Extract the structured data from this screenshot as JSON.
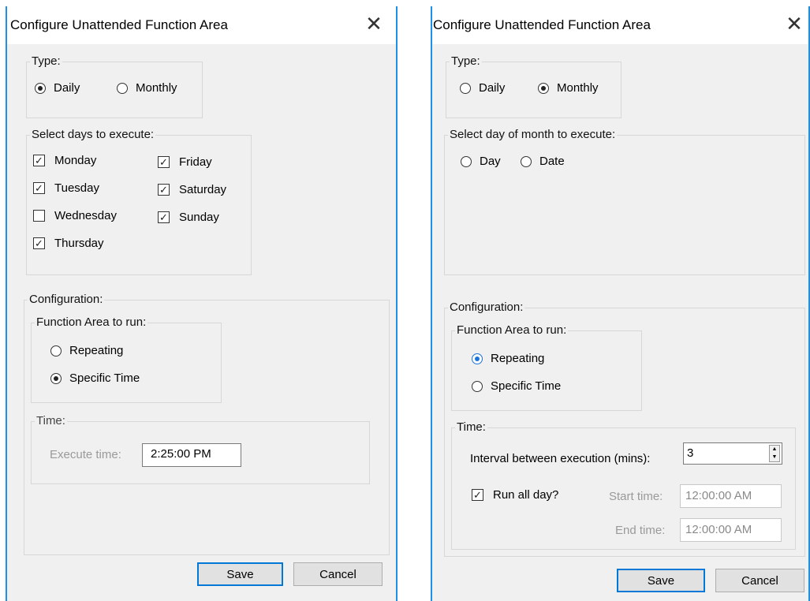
{
  "left": {
    "title": "Configure Unattended Function Area",
    "type_label": "Type:",
    "type_daily": "Daily",
    "type_monthly": "Monthly",
    "days_label": "Select days to execute:",
    "days": [
      "Monday",
      "Tuesday",
      "Wednesday",
      "Thursday",
      "Friday",
      "Saturday",
      "Sunday"
    ],
    "days_checked": [
      true,
      true,
      false,
      true,
      true,
      true,
      true
    ],
    "config_label": "Configuration:",
    "fa_label": "Function Area to run:",
    "repeating": "Repeating",
    "specific_time": "Specific Time",
    "time_label": "Time:",
    "execute_time_label": "Execute time:",
    "execute_time_value": "2:25:00 PM",
    "save": "Save",
    "cancel": "Cancel"
  },
  "right": {
    "title": "Configure Unattended Function Area",
    "type_label": "Type:",
    "type_daily": "Daily",
    "type_monthly": "Monthly",
    "dom_label": "Select day of month to execute:",
    "day_opt": "Day",
    "date_opt": "Date",
    "config_label": "Configuration:",
    "fa_label": "Function Area to run:",
    "repeating": "Repeating",
    "specific_time": "Specific Time",
    "time_label": "Time:",
    "interval_label": "Interval between execution (mins):",
    "interval_value": "3",
    "run_all_day": "Run all day?",
    "start_label": "Start time:",
    "start_value": "12:00:00 AM",
    "end_label": "End time:",
    "end_value": "12:00:00 AM",
    "save": "Save",
    "cancel": "Cancel"
  },
  "icons": {
    "close": "close-icon",
    "check": "checkmark-icon",
    "spin": "spinner-arrows-icon"
  },
  "colors": {
    "window_border": "#1e90e6",
    "primary_border": "#0078d7",
    "radio_accent": "#1a73d9",
    "dialog_bg": "#f0f0f0"
  }
}
